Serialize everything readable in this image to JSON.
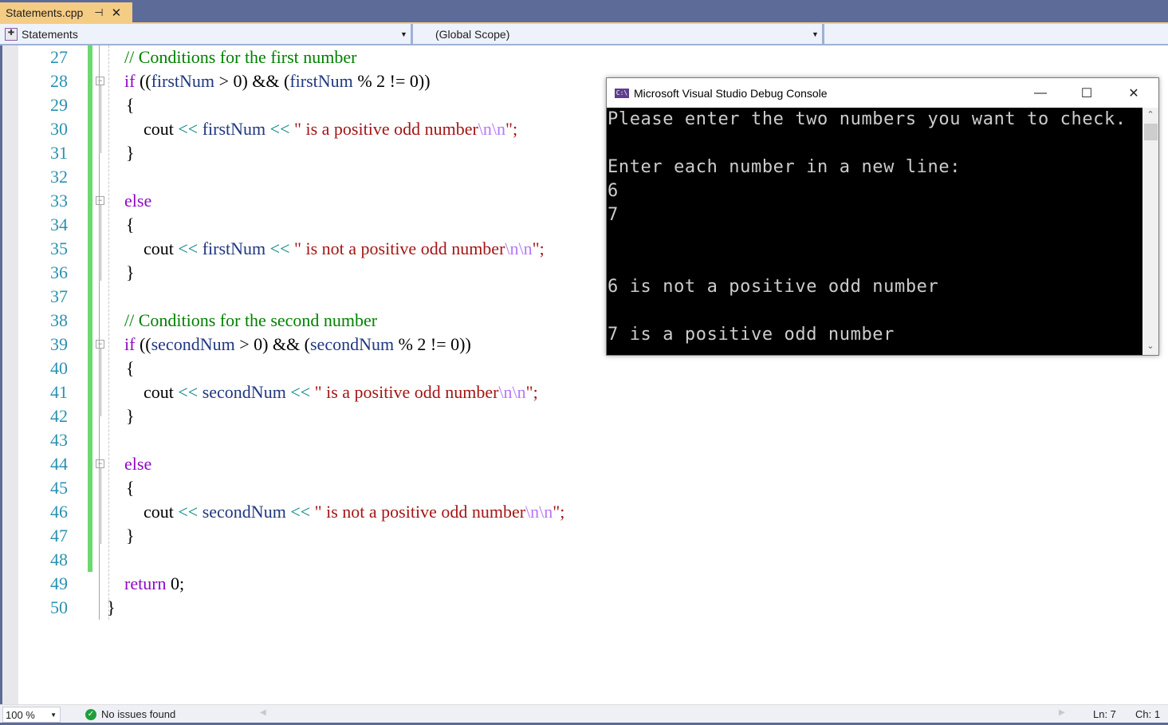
{
  "tab": {
    "filename": "Statements.cpp",
    "pin_icon": "pin-icon",
    "close_icon": "close-icon"
  },
  "navbar": {
    "project": "Statements",
    "scope": "(Global Scope)",
    "member": ""
  },
  "editor": {
    "lines": [
      {
        "n": "27"
      },
      {
        "n": "28"
      },
      {
        "n": "29"
      },
      {
        "n": "30"
      },
      {
        "n": "31"
      },
      {
        "n": "32"
      },
      {
        "n": "33"
      },
      {
        "n": "34"
      },
      {
        "n": "35"
      },
      {
        "n": "36"
      },
      {
        "n": "37"
      },
      {
        "n": "38"
      },
      {
        "n": "39"
      },
      {
        "n": "40"
      },
      {
        "n": "41"
      },
      {
        "n": "42"
      },
      {
        "n": "43"
      },
      {
        "n": "44"
      },
      {
        "n": "45"
      },
      {
        "n": "46"
      },
      {
        "n": "47"
      },
      {
        "n": "48"
      },
      {
        "n": "49"
      },
      {
        "n": "50"
      }
    ],
    "code": {
      "l27": "// Conditions for the first number",
      "l28_kw": "if",
      "l28_a": " ((",
      "l28_id1": "firstNum",
      "l28_b": " > 0) && (",
      "l28_id2": "firstNum",
      "l28_c": " % 2 != 0))",
      "l29": "{",
      "l30_cout": "cout ",
      "l30_op1": "<<",
      "l30_id": " firstNum ",
      "l30_op2": "<<",
      "l30_str": " \" is a positive odd number",
      "l30_esc": "\\n\\n",
      "l30_end": "\";",
      "l31": "}",
      "l33_kw": "else",
      "l34": "{",
      "l35_cout": "cout ",
      "l35_op1": "<<",
      "l35_id": " firstNum ",
      "l35_op2": "<<",
      "l35_str": " \" is not a positive odd number",
      "l35_esc": "\\n\\n",
      "l35_end": "\";",
      "l36": "}",
      "l38": "// Conditions for the second number",
      "l39_kw": "if",
      "l39_a": " ((",
      "l39_id1": "secondNum",
      "l39_b": " > 0) && (",
      "l39_id2": "secondNum",
      "l39_c": " % 2 != 0))",
      "l40": "{",
      "l41_cout": "cout ",
      "l41_op1": "<<",
      "l41_id": " secondNum ",
      "l41_op2": "<<",
      "l41_str": " \" is a positive odd number",
      "l41_esc": "\\n\\n",
      "l41_end": "\";",
      "l42": "}",
      "l44_kw": "else",
      "l45": "{",
      "l46_cout": "cout ",
      "l46_op1": "<<",
      "l46_id": " secondNum ",
      "l46_op2": "<<",
      "l46_str": " \" is not a positive odd number",
      "l46_esc": "\\n\\n",
      "l46_end": "\";",
      "l47": "}",
      "l49_kw": "return",
      "l49_rest": " 0;",
      "l50": "}"
    }
  },
  "console": {
    "title": "Microsoft Visual Studio Debug Console",
    "icon_label": "C:\\",
    "minimize": "—",
    "maximize": "☐",
    "close": "✕",
    "lines": [
      "Please enter the two numbers you want to check.",
      "",
      "Enter each number in a new line:",
      "6",
      "7",
      "",
      "",
      "6 is not a positive odd number",
      "",
      "7 is a positive odd number"
    ]
  },
  "statusbar": {
    "zoom": "100 %",
    "issues": "No issues found",
    "line": "Ln: 7",
    "char": "Ch: 1"
  },
  "colors": {
    "keyword": "#8f08c4",
    "identifier": "#1f377f",
    "operator": "#008080",
    "string": "#a31515",
    "escape": "#b776fb",
    "comment": "#008000",
    "line_number": "#2b91af",
    "tab_active": "#f5cc84",
    "chrome": "#5d6b99",
    "change_bar": "#6ed76e"
  }
}
